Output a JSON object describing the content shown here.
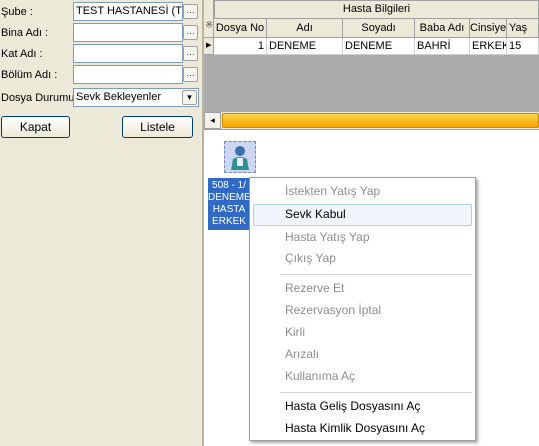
{
  "filters": {
    "sube_label": "Şube :",
    "sube_value": "TEST HASTANESİ (TEST)",
    "bina_label": "Bina Adı :",
    "bina_value": "",
    "kat_label": "Kat Adı :",
    "kat_value": "",
    "bolum_label": "Bölüm Adı :",
    "bolum_value": "",
    "durum_label": "Dosya Durumu:",
    "durum_value": "Sevk Bekleyenler",
    "lookup_glyph": "…",
    "dropdown_glyph": "▾"
  },
  "buttons": {
    "kapat": "Kapat",
    "listele": "Listele"
  },
  "grid": {
    "caption": "Hasta Bilgileri",
    "new_row_marker": "※",
    "row_indicator": "▶",
    "columns": [
      "Dosya No",
      "Adı",
      "Soyadı",
      "Baba Adı",
      "Cinsiyet",
      "Yaş"
    ],
    "rows": [
      [
        "1",
        "DENEME",
        "DENEME",
        "BAHRİ",
        "ERKEK",
        "15"
      ]
    ]
  },
  "scroll": {
    "left_arrow": "◂"
  },
  "bed": {
    "lines": [
      "508 - 1/",
      "DENEME",
      "HASTA",
      "ERKEK"
    ]
  },
  "context_menu": {
    "items": [
      {
        "label": "İstekten Yatış Yap",
        "enabled": false
      },
      {
        "label": "Sevk Kabul",
        "enabled": true,
        "highlighted": true
      },
      {
        "label": "Hasta Yatış Yap",
        "enabled": false
      },
      {
        "label": "Çıkış Yap",
        "enabled": false
      },
      {
        "label": "Rezerve Et",
        "enabled": false
      },
      {
        "label": "Rezervasyon İptal",
        "enabled": false
      },
      {
        "label": "Kirli",
        "enabled": false
      },
      {
        "label": "Arızalı",
        "enabled": false
      },
      {
        "label": "Kullanıma Aç",
        "enabled": false
      },
      {
        "label": "Hasta Geliş Dosyasını Aç",
        "enabled": true
      },
      {
        "label": "Hasta Kimlik Dosyasını Aç",
        "enabled": true
      }
    ]
  },
  "colors": {
    "selection": "#316ac5",
    "scroll_thumb": "#f5a400",
    "menu_hover": "#f1f6fd"
  }
}
